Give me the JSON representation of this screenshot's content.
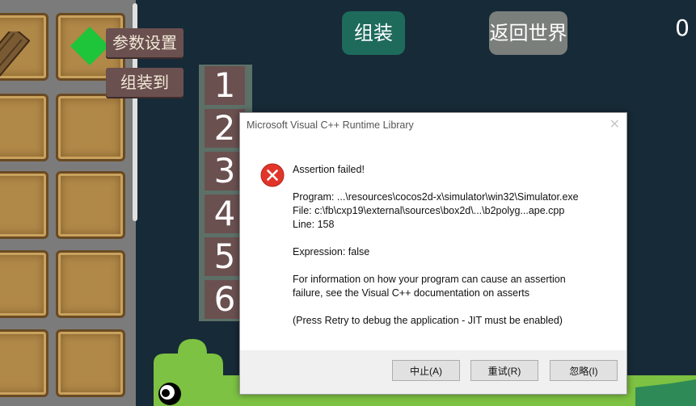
{
  "game": {
    "assemble_button": "组装",
    "return_world_button": "返回世界",
    "score": "0",
    "param_settings_button": "参数设置",
    "assemble_to_button": "组装到",
    "slot_numbers": [
      "1",
      "2",
      "3",
      "4",
      "5",
      "6"
    ]
  },
  "dialog": {
    "title": "Microsoft Visual C++ Runtime Library",
    "close_glyph": "✕",
    "assertion": "Assertion failed!",
    "program": "Program: ...\\resources\\cocos2d-x\\simulator\\win32\\Simulator.exe",
    "file": "File: c:\\fb\\cxp19\\external\\sources\\box2d\\...\\b2polyg...ape.cpp",
    "line": "Line: 158",
    "expression": "Expression: false",
    "info_line1": "For information on how your program can cause an assertion",
    "info_line2": "failure, see the Visual C++ documentation on asserts",
    "retry_hint": "(Press Retry to debug the application - JIT must be enabled)",
    "buttons": {
      "abort": "中止(A)",
      "retry": "重试(R)",
      "ignore": "忽略(I)"
    }
  },
  "colors": {
    "background": "#172a37",
    "assemble_button_bg": "#1e6b5c",
    "return_button_bg": "#7a7f7c",
    "tag_bg": "#6b5050",
    "error_red": "#e2352a",
    "creature_green": "#7dc242"
  },
  "icons": {
    "error": "error-circle-icon",
    "gem": "green-diamond-icon",
    "log": "wood-log-icon"
  }
}
